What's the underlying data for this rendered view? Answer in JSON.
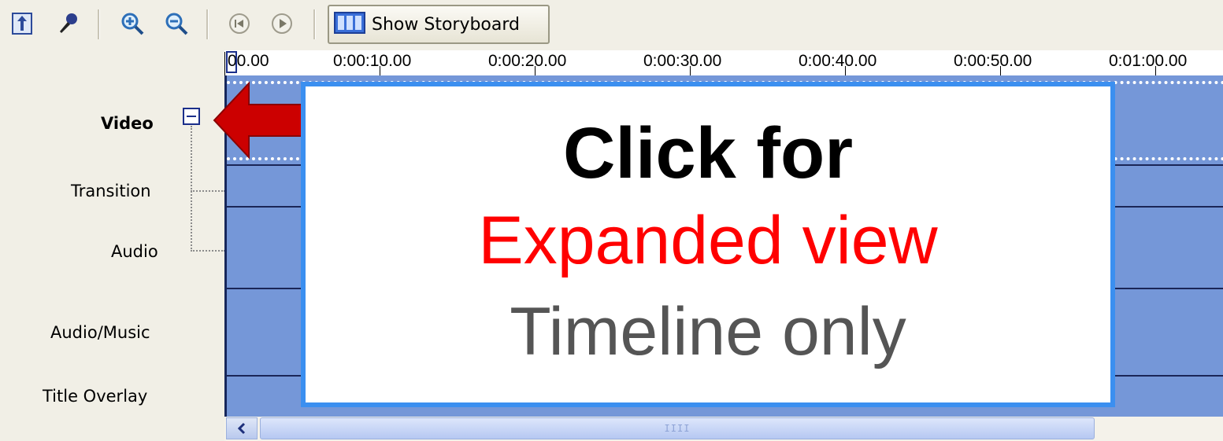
{
  "toolbar": {
    "icons": [
      "timeline-narration-icon",
      "audio-levels-icon",
      "zoom-in-icon",
      "zoom-out-icon",
      "rewind-icon",
      "play-icon",
      "storyboard-icon"
    ],
    "storyboard_label": "Show Storyboard"
  },
  "ruler": {
    "ticks": [
      "00.00",
      "0:00:10.00",
      "0:00:20.00",
      "0:00:30.00",
      "0:00:40.00",
      "0:00:50.00",
      "0:01:00.00"
    ]
  },
  "tracks": {
    "video": "Video",
    "transition": "Transition",
    "audio": "Audio",
    "audio_music": "Audio/Music",
    "title_overlay": "Title Overlay"
  },
  "callout": {
    "line1": "Click for",
    "line2": "Expanded view",
    "line3": "Timeline only"
  },
  "colors": {
    "track_bg": "#7597d8",
    "callout_border": "#3b8ff0",
    "arrow": "#cc0000",
    "highlight_text": "#ff0000"
  }
}
